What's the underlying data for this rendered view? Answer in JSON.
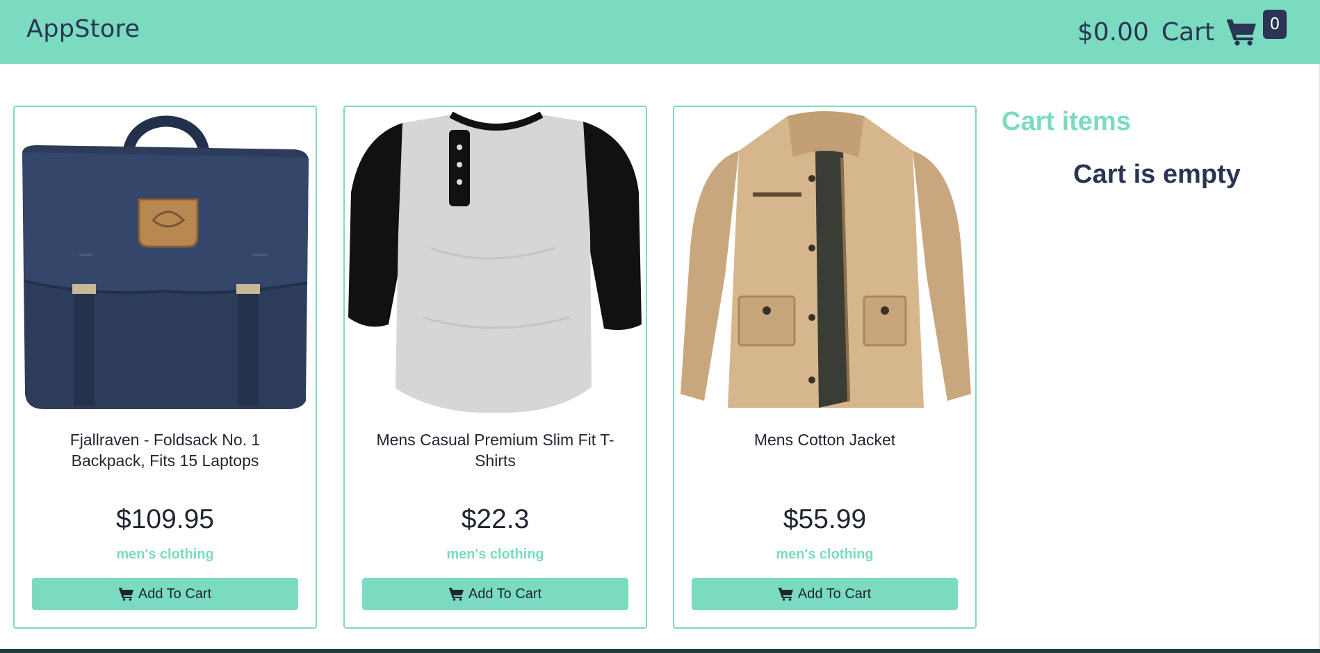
{
  "header": {
    "brand": "AppStore",
    "total": "$0.00",
    "cart_label": "Cart",
    "cart_count": "0",
    "cart_icon": "shopping-cart-icon"
  },
  "products": [
    {
      "title": "Fjallraven - Foldsack No. 1 Backpack, Fits 15 Laptops",
      "price": "$109.95",
      "category": "men's clothing",
      "button_label": "Add To Cart",
      "image": "backpack-image"
    },
    {
      "title": "Mens Casual Premium Slim Fit T-Shirts",
      "price": "$22.3",
      "category": "men's clothing",
      "button_label": "Add To Cart",
      "image": "tshirt-image"
    },
    {
      "title": "Mens Cotton Jacket",
      "price": "$55.99",
      "category": "men's clothing",
      "button_label": "Add To Cart",
      "image": "jacket-image"
    }
  ],
  "cart_panel": {
    "title": "Cart items",
    "empty_message": "Cart is empty"
  },
  "colors": {
    "accent": "#7adbc1",
    "dark": "#2b3452"
  }
}
